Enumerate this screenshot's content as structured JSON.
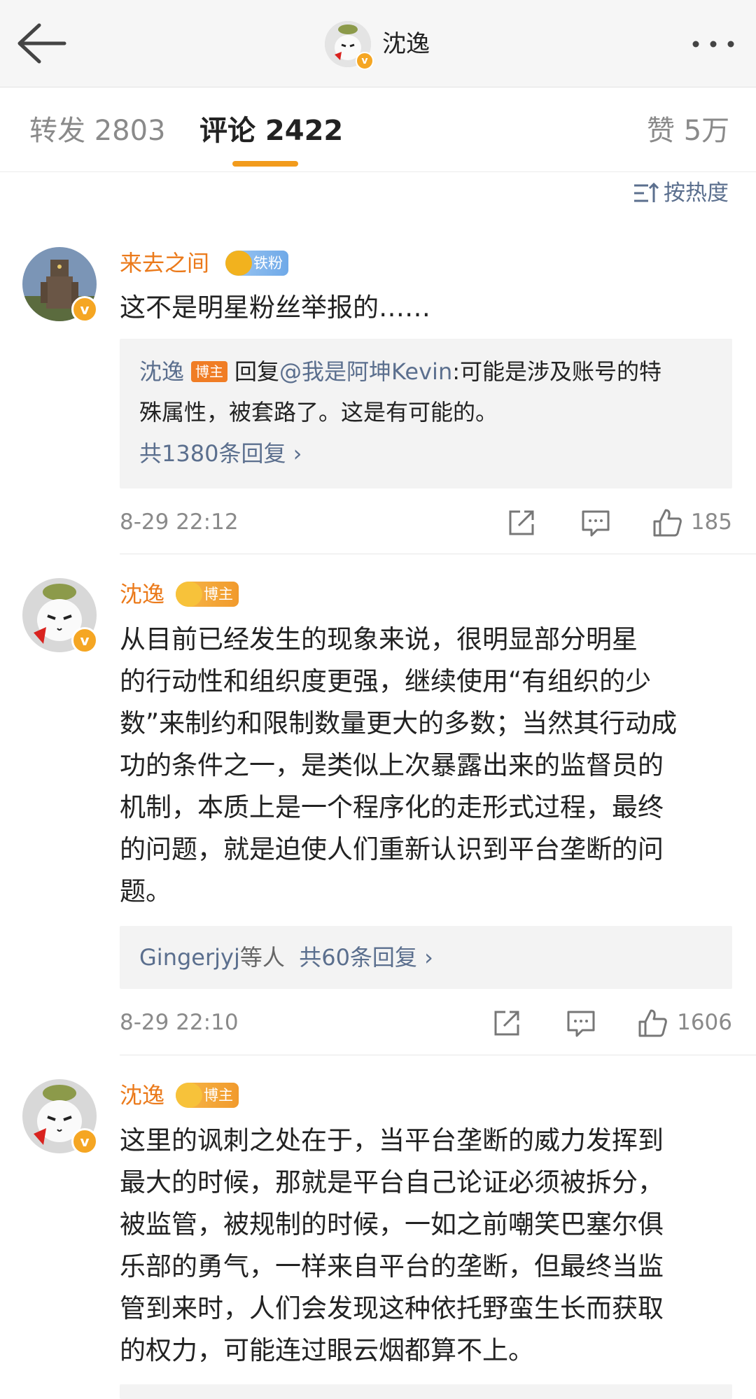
{
  "header": {
    "title": "沈逸",
    "back_icon": "back-arrow-icon",
    "more_icon": "more-dots-icon"
  },
  "tabs": [
    {
      "label": "转发 2803"
    },
    {
      "label": "评论 2422",
      "active": true
    },
    {
      "label": "赞 5万"
    }
  ],
  "sort": {
    "label": "按热度",
    "icon": "sort-icon"
  },
  "colors": {
    "accent": "#f29b1c",
    "username": "#eb7a1b",
    "link": "#5b6f8e"
  },
  "comments": [
    {
      "username": "来去之间",
      "badge": "铁粉",
      "text": "这不是明星粉丝举报的……",
      "reply": {
        "name": "沈逸",
        "tag": "博主",
        "prefix": "回复",
        "mention": "@我是阿坤Kevin",
        "text_line1": ":可能是涉及账号的特",
        "text_line2": "殊属性，被套路了。这是有可能的。",
        "more": "共1380条回复 ›"
      },
      "time": "8-29 22:12",
      "likes": "185"
    },
    {
      "username": "沈逸",
      "badge": "博主",
      "lines": [
        "从目前已经发生的现象来说，很明显部分明星",
        "的行动性和组织度更强，继续使用“有组织的少",
        "数”来制约和限制数量更大的多数；当然其行动成",
        "功的条件之一，是类似上次暴露出来的监督员的",
        "机制，本质上是一个程序化的走形式过程，最终",
        "的问题，就是迫使人们重新认识到平台垄断的问",
        "题。"
      ],
      "reply": {
        "who": "Gingerjyj",
        "who_suffix": "等人",
        "more": "共60条回复 ›"
      },
      "time": "8-29 22:10",
      "likes": "1606"
    },
    {
      "username": "沈逸",
      "badge": "博主",
      "lines": [
        "这里的讽刺之处在于，当平台垄断的威力发挥到",
        "最大的时候，那就是平台自己论证必须被拆分，",
        "被监管，被规制的时候，一如之前嘲笑巴塞尔俱",
        "乐部的勇气，一样来自平台的垄断，但最终当监",
        "管到来时，人们会发现这种依托野蛮生长而获取",
        "的权力，可能连过眼云烟都算不上。"
      ]
    }
  ]
}
